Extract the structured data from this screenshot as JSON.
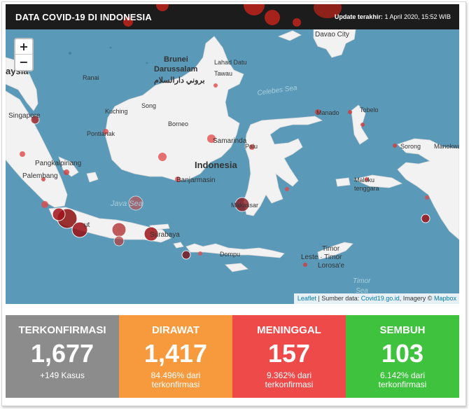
{
  "header": {
    "title": "DATA COVID-19 DI INDONESIA",
    "update_label": "Update terakhir:",
    "update_value": "1 April 2020, 15:52 WIB"
  },
  "map": {
    "zoom_in": "+",
    "zoom_out": "−",
    "labels": {
      "davao": "Davao City",
      "brunei": "Brunei",
      "darussalam": "Darussalam",
      "brunei_arabic": "بروني دارالسلام",
      "lahad_datu": "Lahad Datu",
      "tawau": "Tawau",
      "ranai": "Ranai",
      "celebes_sea": "Celebes Sea",
      "malaysia_partial": "aysia",
      "singapore": "Singapore",
      "kuching": "Kuching",
      "song": "Song",
      "borneo": "Borneo",
      "pontianak": "Pontianak",
      "samarinda": "Samarinda",
      "manado": "Manado",
      "tobelo": "Tobelo",
      "palu": "Palu",
      "sorong": "Sorong",
      "manokwari": "Manokwari",
      "pangkalpinang": "Pangkalpinang",
      "palembang": "Palembang",
      "indonesia": "Indonesia",
      "banjarmasin": "Banjarmasin",
      "maluku_1": "Maluku",
      "maluku_2": "tenggara",
      "java_sea": "Java Sea",
      "makassar": "Makassar",
      "surabaya": "Surabaya",
      "bandung_partial": "ut",
      "dompu": "Dompu",
      "timor_1": "Timor",
      "timor_2": "Leste · Timor",
      "timor_3": "Lorosa'e",
      "timor_sea_1": "Timor",
      "timor_sea_2": "Sea"
    },
    "attribution": {
      "leaflet": "Leaflet",
      "source_label": "| Sumber data:",
      "source_link": "Covid19.go.id",
      "imagery_label": ", Imagery ©",
      "mapbox": "Mapbox"
    }
  },
  "stats": [
    {
      "label": "TERKONFIRMASI",
      "value": "1,677",
      "sub": "+149 Kasus",
      "color": "#8c8c8c"
    },
    {
      "label": "DIRAWAT",
      "value": "1,417",
      "sub": "84.496% dari terkonfirmasi",
      "color": "#f79a3e"
    },
    {
      "label": "MENINGGAL",
      "value": "157",
      "sub": "9.362% dari terkonfirmasi",
      "color": "#ef4a4a"
    },
    {
      "label": "SEMBUH",
      "value": "103",
      "sub": "6.142% dari terkonfirmasi",
      "color": "#3fc33f"
    }
  ]
}
